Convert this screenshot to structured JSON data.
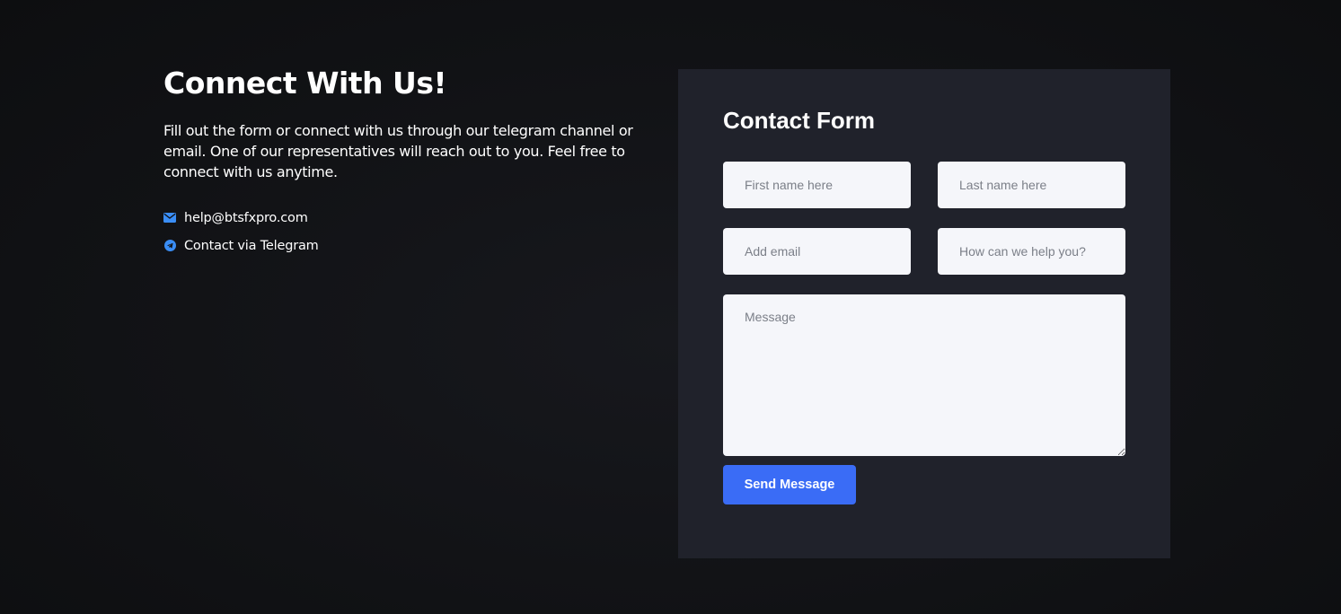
{
  "left": {
    "heading": "Connect With Us!",
    "intro": "Fill out the form or connect with us through our telegram channel or email. One of our representatives will reach out to you. Feel free to connect with us anytime.",
    "contacts": [
      {
        "icon": "envelope-icon",
        "label": "help@btsfxpro.com"
      },
      {
        "icon": "telegram-icon",
        "label": "Contact via Telegram"
      }
    ]
  },
  "form": {
    "title": "Contact Form",
    "first_name_placeholder": "First name here",
    "last_name_placeholder": "Last name here",
    "email_placeholder": "Add email",
    "help_placeholder": "How can we help you?",
    "message_placeholder": "Message",
    "submit_label": "Send Message"
  },
  "colors": {
    "accent": "#3a6cf6",
    "panel": "#20222b",
    "background": "#111215",
    "field": "#f5f6fa"
  }
}
